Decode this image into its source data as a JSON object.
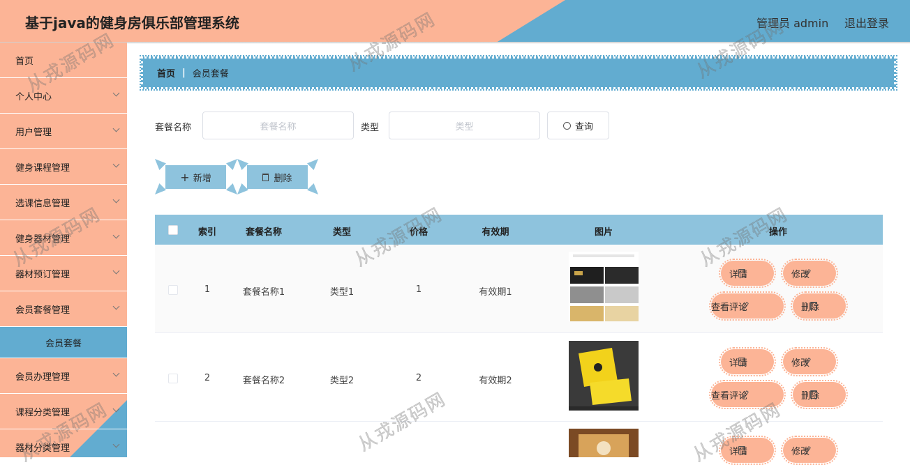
{
  "header": {
    "title": "基于java的健身房俱乐部管理系统",
    "user": "管理员 admin",
    "logout": "退出登录"
  },
  "sidebar": {
    "items": [
      {
        "label": "首页",
        "expandable": false
      },
      {
        "label": "个人中心",
        "expandable": true
      },
      {
        "label": "用户管理",
        "expandable": true
      },
      {
        "label": "健身课程管理",
        "expandable": true
      },
      {
        "label": "选课信息管理",
        "expandable": true
      },
      {
        "label": "健身器材管理",
        "expandable": true
      },
      {
        "label": "器材预订管理",
        "expandable": true
      },
      {
        "label": "会员套餐管理",
        "expandable": true
      }
    ],
    "active_sub": "会员套餐",
    "items_after": [
      {
        "label": "会员办理管理",
        "expandable": true
      },
      {
        "label": "课程分类管理",
        "expandable": true
      },
      {
        "label": "器材分类管理",
        "expandable": true
      }
    ]
  },
  "breadcrumb": {
    "home": "首页",
    "sep": "|",
    "current": "会员套餐"
  },
  "search": {
    "name_label": "套餐名称",
    "name_placeholder": "套餐名称",
    "type_label": "类型",
    "type_placeholder": "类型",
    "query_button": "查询"
  },
  "actions": {
    "add": "新增",
    "delete": "删除"
  },
  "table": {
    "columns": [
      "索引",
      "套餐名称",
      "类型",
      "价格",
      "有效期",
      "图片",
      "操作"
    ],
    "rows": [
      {
        "index": "1",
        "name": "套餐名称1",
        "type": "类型1",
        "price": "1",
        "validity": "有效期1"
      },
      {
        "index": "2",
        "name": "套餐名称2",
        "type": "类型2",
        "price": "2",
        "validity": "有效期2"
      },
      {
        "index": "",
        "name": "",
        "type": "",
        "price": "",
        "validity": ""
      }
    ],
    "ops": {
      "detail": "详情",
      "edit": "修改",
      "comments": "查看评论",
      "delete": "删除"
    }
  },
  "watermark": "从戎源码网",
  "colors": {
    "salmon": "#fcb496",
    "blue": "#62acd0",
    "light_blue": "#8ec3dd"
  }
}
